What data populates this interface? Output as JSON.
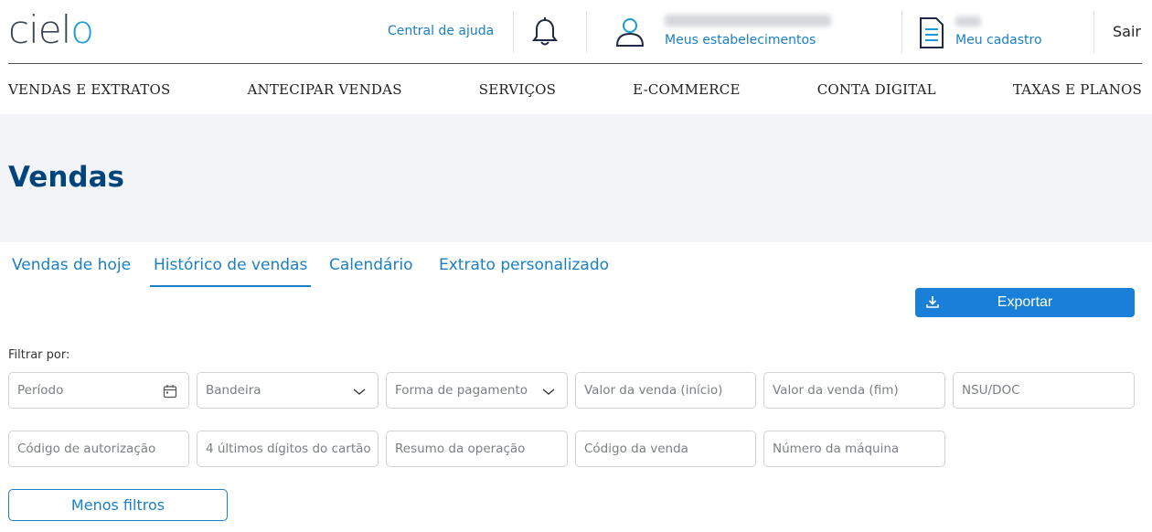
{
  "header": {
    "logo": {
      "prefix": "ciel",
      "suffix": "o"
    },
    "help_link": "Central de ajuda",
    "stores_link": "Meus estabelecimentos",
    "profile_link": "Meu cadastro",
    "logout": "Sair"
  },
  "nav": {
    "items": [
      {
        "label": "VENDAS E EXTRATOS"
      },
      {
        "label": "ANTECIPAR VENDAS"
      },
      {
        "label": "SERVIÇOS"
      },
      {
        "label": "E-COMMERCE"
      },
      {
        "label": "CONTA DIGITAL"
      },
      {
        "label": "TAXAS E PLANOS"
      }
    ]
  },
  "page": {
    "title": "Vendas"
  },
  "tabs": [
    {
      "label": "Vendas de hoje",
      "active": false
    },
    {
      "label": "Histórico de vendas",
      "active": true
    },
    {
      "label": "Calendário",
      "active": false
    },
    {
      "label": "Extrato personalizado",
      "active": false
    }
  ],
  "toolbar": {
    "export_label": "Exportar"
  },
  "filters": {
    "label": "Filtrar por:",
    "period": "Período",
    "brand": "Bandeira",
    "payment": "Forma de pagamento",
    "value_start": "Valor da venda (início)",
    "value_end": "Valor da venda (fim)",
    "nsu": "NSU/DOC",
    "auth_code": "Código de autorização",
    "last_digits": "4 últimos dígitos do cartão",
    "summary": "Resumo da operação",
    "sale_code": "Código da venda",
    "machine": "Número da máquina",
    "less_label": "Menos filtros"
  },
  "colors": {
    "accent": "#1a7fc4",
    "button": "#1a7fd8",
    "title": "#00447c",
    "banner": "#f2f4f7"
  },
  "icons": [
    "bell-icon",
    "user-icon",
    "document-icon",
    "calendar-icon",
    "chevron-down-icon",
    "download-icon"
  ]
}
